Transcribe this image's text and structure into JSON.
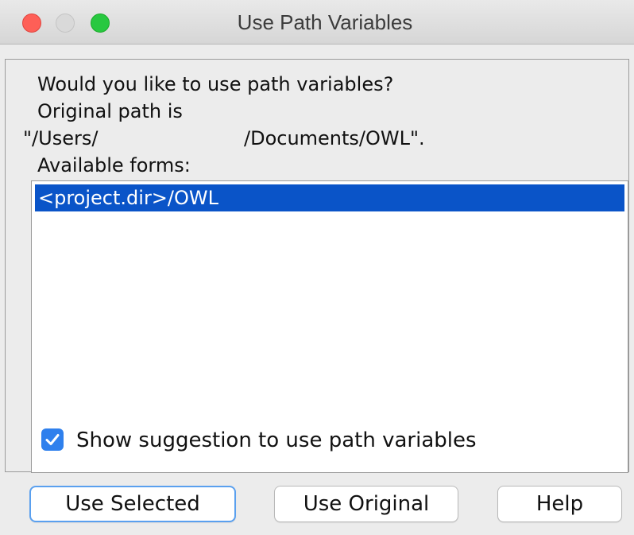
{
  "window": {
    "title": "Use Path Variables"
  },
  "message": {
    "question": "Would you like to use path variables?",
    "original_label": "Original path is",
    "path_prefix": "\"/Users/",
    "path_suffix": "/Documents/OWL\".",
    "forms_label": "Available forms:"
  },
  "forms_list": {
    "items": [
      {
        "label": "<project.dir>/OWL",
        "selected": true
      }
    ]
  },
  "suggestion_checkbox": {
    "label": "Show suggestion to use path variables",
    "checked": true
  },
  "buttons": {
    "use_selected": "Use Selected",
    "use_original": "Use Original",
    "help": "Help"
  },
  "colors": {
    "selection": "#0a54c8",
    "checkbox": "#2f80ed",
    "close": "#fe5f57",
    "zoom": "#28c840"
  }
}
